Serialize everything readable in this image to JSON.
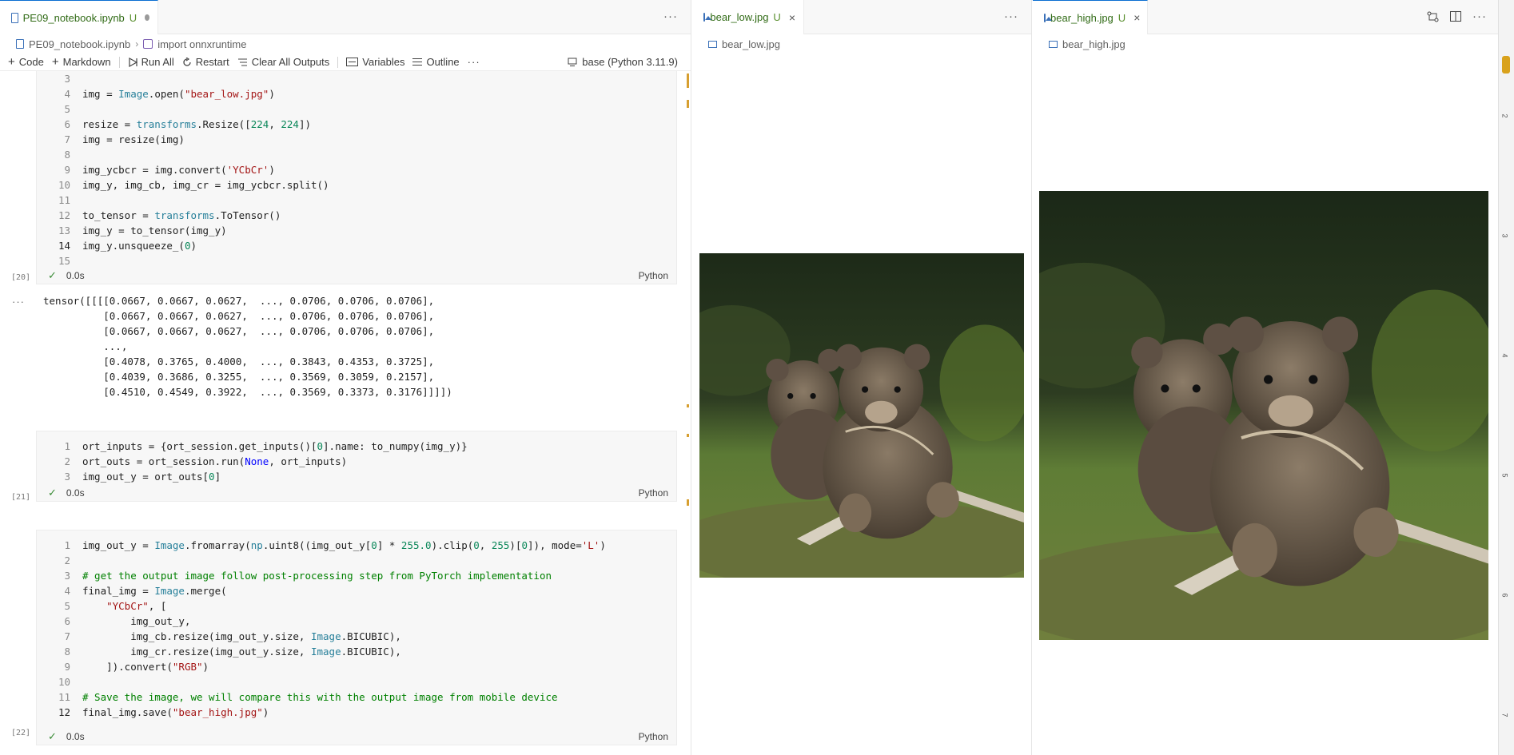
{
  "notebook_pane": {
    "tab": {
      "title": "PE09_notebook.ipynb",
      "modified": "U"
    },
    "more": "···",
    "breadcrumb": {
      "file": "PE09_notebook.ipynb",
      "separator": "›",
      "symbol": "import onnxruntime"
    },
    "toolbar": {
      "code": "Code",
      "markdown": "Markdown",
      "run_all": "Run All",
      "restart": "Restart",
      "clear_outputs": "Clear All Outputs",
      "variables": "Variables",
      "outline": "Outline",
      "more": "···",
      "kernel": "base (Python 3.11.9)"
    },
    "cells": [
      {
        "exec_count": "[20]",
        "time": "0.0s",
        "lang": "Python",
        "lines": [
          {
            "n": "3",
            "code": ""
          },
          {
            "n": "4",
            "code": "img = Image.open(\"bear_low.jpg\")"
          },
          {
            "n": "5",
            "code": ""
          },
          {
            "n": "6",
            "code": "resize = transforms.Resize([224, 224])"
          },
          {
            "n": "7",
            "code": "img = resize(img)"
          },
          {
            "n": "8",
            "code": ""
          },
          {
            "n": "9",
            "code": "img_ycbcr = img.convert('YCbCr')"
          },
          {
            "n": "10",
            "code": "img_y, img_cb, img_cr = img_ycbcr.split()"
          },
          {
            "n": "11",
            "code": ""
          },
          {
            "n": "12",
            "code": "to_tensor = transforms.ToTensor()"
          },
          {
            "n": "13",
            "code": "img_y = to_tensor(img_y)"
          },
          {
            "n": "14",
            "code": "img_y.unsqueeze_(0)"
          },
          {
            "n": "15",
            "code": ""
          }
        ],
        "output_more": "···",
        "output": [
          "tensor([[[[0.0667, 0.0667, 0.0627,  ..., 0.0706, 0.0706, 0.0706],",
          "          [0.0667, 0.0667, 0.0627,  ..., 0.0706, 0.0706, 0.0706],",
          "          [0.0667, 0.0667, 0.0627,  ..., 0.0706, 0.0706, 0.0706],",
          "          ...,",
          "          [0.4078, 0.3765, 0.4000,  ..., 0.3843, 0.4353, 0.3725],",
          "          [0.4039, 0.3686, 0.3255,  ..., 0.3569, 0.3059, 0.2157],",
          "          [0.4510, 0.4549, 0.3922,  ..., 0.3569, 0.3373, 0.3176]]]])"
        ]
      },
      {
        "exec_count": "[21]",
        "time": "0.0s",
        "lang": "Python",
        "lines": [
          {
            "n": "1",
            "code": "ort_inputs = {ort_session.get_inputs()[0].name: to_numpy(img_y)}"
          },
          {
            "n": "2",
            "code": "ort_outs = ort_session.run(None, ort_inputs)"
          },
          {
            "n": "3",
            "code": "img_out_y = ort_outs[0]"
          }
        ]
      },
      {
        "exec_count": "[22]",
        "time": "0.0s",
        "lang": "Python",
        "lines": [
          {
            "n": "1",
            "code": "img_out_y = Image.fromarray(np.uint8((img_out_y[0] * 255.0).clip(0, 255)[0]), mode='L')"
          },
          {
            "n": "2",
            "code": ""
          },
          {
            "n": "3",
            "code": "# get the output image follow post-processing step from PyTorch implementation"
          },
          {
            "n": "4",
            "code": "final_img = Image.merge("
          },
          {
            "n": "5",
            "code": "    \"YCbCr\", ["
          },
          {
            "n": "6",
            "code": "        img_out_y,"
          },
          {
            "n": "7",
            "code": "        img_cb.resize(img_out_y.size, Image.BICUBIC),"
          },
          {
            "n": "8",
            "code": "        img_cr.resize(img_out_y.size, Image.BICUBIC),"
          },
          {
            "n": "9",
            "code": "    ]).convert(\"RGB\")"
          },
          {
            "n": "10",
            "code": ""
          },
          {
            "n": "11",
            "code": "# Save the image, we will compare this with the output image from mobile device"
          },
          {
            "n": "12",
            "code": "final_img.save(\"bear_high.jpg\")"
          }
        ]
      }
    ]
  },
  "low_pane": {
    "tab": {
      "title": "bear_low.jpg",
      "modified": "U",
      "close": "×"
    },
    "more": "···",
    "breadcrumb": "bear_low.jpg"
  },
  "high_pane": {
    "tab": {
      "title": "bear_high.jpg",
      "modified": "U",
      "close": "×"
    },
    "more": "···",
    "breadcrumb": "bear_high.jpg"
  },
  "scrollbar_ruler": [
    "2",
    "3",
    "4",
    "5",
    "6",
    "7"
  ],
  "colors": {
    "accent": "#0a6ed1",
    "modified": "#5a8f2f",
    "check": "#388a34",
    "keyword_string": "#a31515",
    "comment": "#008000",
    "number": "#098658",
    "class": "#267f99"
  }
}
